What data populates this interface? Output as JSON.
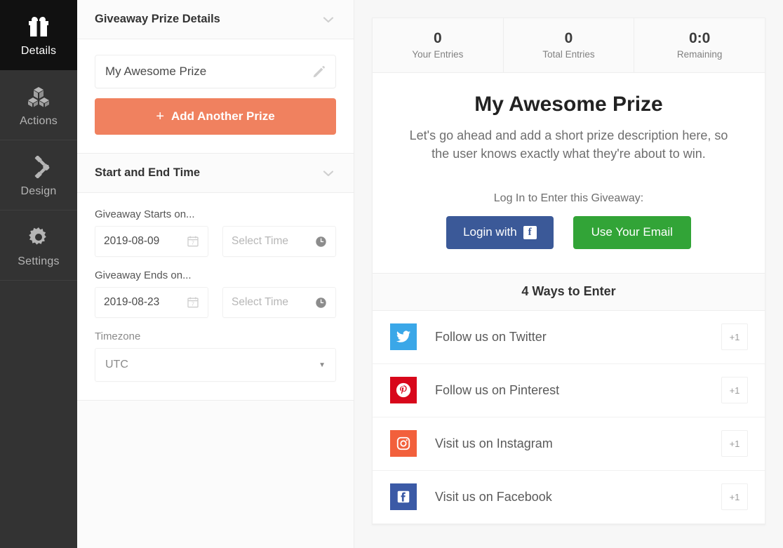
{
  "sidebar": {
    "items": [
      {
        "label": "Details",
        "icon": "gift-icon",
        "active": true
      },
      {
        "label": "Actions",
        "icon": "blocks-icon",
        "active": false
      },
      {
        "label": "Design",
        "icon": "brush-icon",
        "active": false
      },
      {
        "label": "Settings",
        "icon": "gear-icon",
        "active": false
      }
    ]
  },
  "editor": {
    "prize_section": {
      "title": "Giveaway Prize Details",
      "collapse_icon": "chevron-down-icon",
      "prize_value": "My Awesome Prize",
      "prize_edit_icon": "pencil-icon",
      "add_prize_label": "Add Another Prize",
      "add_prize_plus": "+"
    },
    "time_section": {
      "title": "Start and End Time",
      "collapse_icon": "chevron-down-icon",
      "starts_label": "Giveaway Starts on...",
      "start_date": "2019-08-09",
      "start_time_placeholder": "Select Time",
      "ends_label": "Giveaway Ends on...",
      "end_date": "2019-08-23",
      "end_time_placeholder": "Select Time",
      "timezone_label": "Timezone",
      "timezone_value": "UTC",
      "timezone_caret": "▼",
      "calendar_icon": "calendar-icon",
      "clock_icon": "clock-icon"
    }
  },
  "preview": {
    "stats": [
      {
        "value": "0",
        "caption": "Your Entries"
      },
      {
        "value": "0",
        "caption": "Total Entries"
      },
      {
        "value": "0:0",
        "caption": "Remaining"
      }
    ],
    "prize_title": "My Awesome Prize",
    "prize_description": "Let's go ahead and add a short prize description here, so the user knows exactly what they're about to win.",
    "login_prompt": "Log In to Enter this Giveaway:",
    "facebook_login_label": "Login with",
    "facebook_glyph": "f",
    "email_login_label": "Use Your Email",
    "ways_title": "4 Ways to Enter",
    "entries": [
      {
        "label": "Follow us on Twitter",
        "points": "+1",
        "icon": "twitter-icon",
        "color": "#3aa7e8"
      },
      {
        "label": "Follow us on Pinterest",
        "points": "+1",
        "icon": "pinterest-icon",
        "color": "#d8071b"
      },
      {
        "label": "Visit us on Instagram",
        "points": "+1",
        "icon": "instagram-icon",
        "color": "#f2603c"
      },
      {
        "label": "Visit us on Facebook",
        "points": "+1",
        "icon": "facebook-icon",
        "color": "#3b5aa6"
      }
    ]
  },
  "colors": {
    "accent_orange": "#f0815f",
    "facebook_blue": "#3b5998",
    "email_green": "#32a437",
    "sidebar_bg": "#333333",
    "sidebar_active_bg": "#111111"
  }
}
